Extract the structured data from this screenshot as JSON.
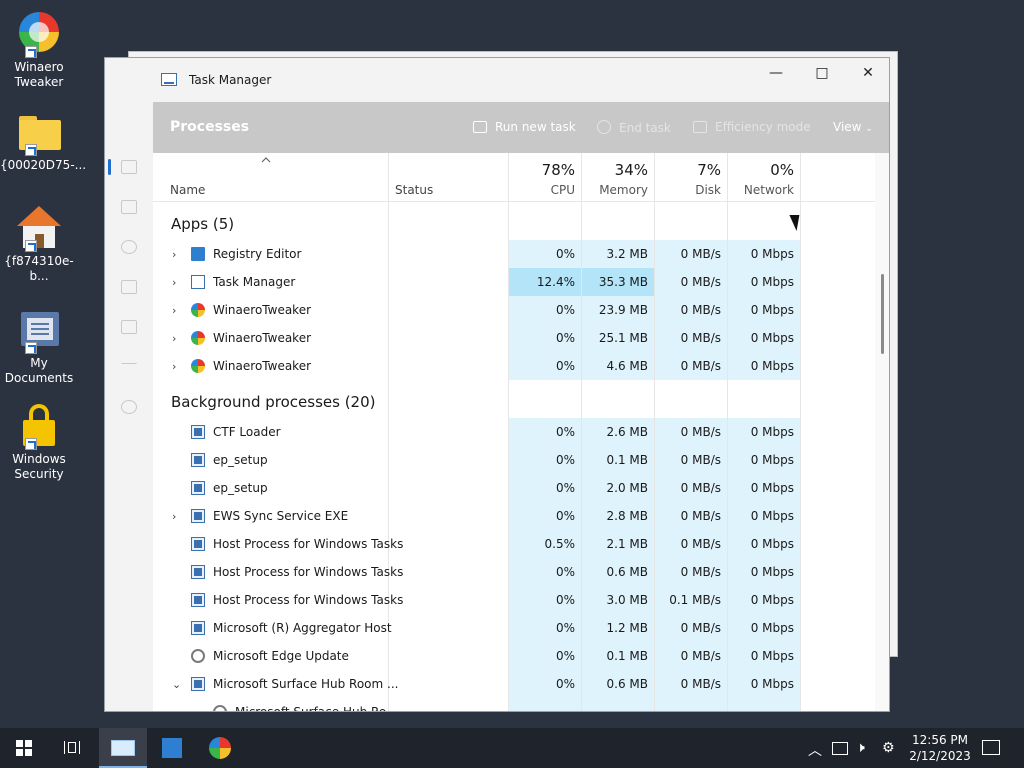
{
  "desktop": {
    "icons": [
      {
        "label": "Winaero\nTweaker",
        "icon": "winaero-icon"
      },
      {
        "label": "{00020D75-...",
        "icon": "folder-icon"
      },
      {
        "label": "{f874310e-b...",
        "icon": "home-icon"
      },
      {
        "label": "My\nDocuments",
        "icon": "documents-icon"
      },
      {
        "label": "Windows\nSecurity",
        "icon": "lock-icon"
      }
    ]
  },
  "window": {
    "title": "Task Manager",
    "controls": {
      "minimize": "—",
      "maximize": "□",
      "close": "✕"
    }
  },
  "toolbar": {
    "heading": "Processes",
    "run_new_task": "Run new task",
    "end_task": "End task",
    "efficiency_mode": "Efficiency mode",
    "view": "View"
  },
  "columns": {
    "name": "Name",
    "status": "Status",
    "cpu": {
      "pct": "78%",
      "label": "CPU"
    },
    "memory": {
      "pct": "34%",
      "label": "Memory"
    },
    "disk": {
      "pct": "7%",
      "label": "Disk"
    },
    "network": {
      "pct": "0%",
      "label": "Network"
    }
  },
  "groups": {
    "apps": "Apps (5)",
    "background": "Background processes (20)"
  },
  "apps": [
    {
      "name": "Registry Editor",
      "icon": "registry-icon",
      "expand": "›",
      "cpu": "0%",
      "mem": "3.2 MB",
      "disk": "0 MB/s",
      "net": "0 Mbps"
    },
    {
      "name": "Task Manager",
      "icon": "task-manager-icon",
      "expand": "›",
      "cpu": "12.4%",
      "mem": "35.3 MB",
      "disk": "0 MB/s",
      "net": "0 Mbps"
    },
    {
      "name": "WinaeroTweaker",
      "icon": "winaero-icon",
      "expand": "›",
      "cpu": "0%",
      "mem": "23.9 MB",
      "disk": "0 MB/s",
      "net": "0 Mbps"
    },
    {
      "name": "WinaeroTweaker",
      "icon": "winaero-icon",
      "expand": "›",
      "cpu": "0%",
      "mem": "25.1 MB",
      "disk": "0 MB/s",
      "net": "0 Mbps"
    },
    {
      "name": "WinaeroTweaker",
      "icon": "winaero-icon",
      "expand": "›",
      "cpu": "0%",
      "mem": "4.6 MB",
      "disk": "0 MB/s",
      "net": "0 Mbps"
    }
  ],
  "background": [
    {
      "name": "CTF Loader",
      "icon": "window-icon",
      "expand": "",
      "cpu": "0%",
      "mem": "2.6 MB",
      "disk": "0 MB/s",
      "net": "0 Mbps"
    },
    {
      "name": "ep_setup",
      "icon": "window-icon",
      "expand": "",
      "cpu": "0%",
      "mem": "0.1 MB",
      "disk": "0 MB/s",
      "net": "0 Mbps"
    },
    {
      "name": "ep_setup",
      "icon": "window-icon",
      "expand": "",
      "cpu": "0%",
      "mem": "2.0 MB",
      "disk": "0 MB/s",
      "net": "0 Mbps"
    },
    {
      "name": "EWS Sync Service EXE",
      "icon": "window-icon",
      "expand": "›",
      "cpu": "0%",
      "mem": "2.8 MB",
      "disk": "0 MB/s",
      "net": "0 Mbps"
    },
    {
      "name": "Host Process for Windows Tasks",
      "icon": "window-icon",
      "expand": "",
      "cpu": "0.5%",
      "mem": "2.1 MB",
      "disk": "0 MB/s",
      "net": "0 Mbps"
    },
    {
      "name": "Host Process for Windows Tasks",
      "icon": "window-icon",
      "expand": "",
      "cpu": "0%",
      "mem": "0.6 MB",
      "disk": "0 MB/s",
      "net": "0 Mbps"
    },
    {
      "name": "Host Process for Windows Tasks",
      "icon": "window-icon",
      "expand": "",
      "cpu": "0%",
      "mem": "3.0 MB",
      "disk": "0.1 MB/s",
      "net": "0 Mbps"
    },
    {
      "name": "Microsoft (R) Aggregator Host",
      "icon": "window-icon",
      "expand": "",
      "cpu": "0%",
      "mem": "1.2 MB",
      "disk": "0 MB/s",
      "net": "0 Mbps"
    },
    {
      "name": "Microsoft Edge Update",
      "icon": "gear-icon",
      "expand": "",
      "cpu": "0%",
      "mem": "0.1 MB",
      "disk": "0 MB/s",
      "net": "0 Mbps"
    },
    {
      "name": "Microsoft Surface Hub Room ...",
      "icon": "window-icon",
      "expand": "⌄",
      "cpu": "0%",
      "mem": "0.6 MB",
      "disk": "0 MB/s",
      "net": "0 Mbps"
    },
    {
      "name": "Microsoft Surface Hub Ro...",
      "icon": "gear-icon",
      "expand": "",
      "cpu": "",
      "mem": "",
      "disk": "",
      "net": ""
    }
  ],
  "taskbar": {
    "clock_time": "12:56 PM",
    "clock_date": "2/12/2023"
  }
}
